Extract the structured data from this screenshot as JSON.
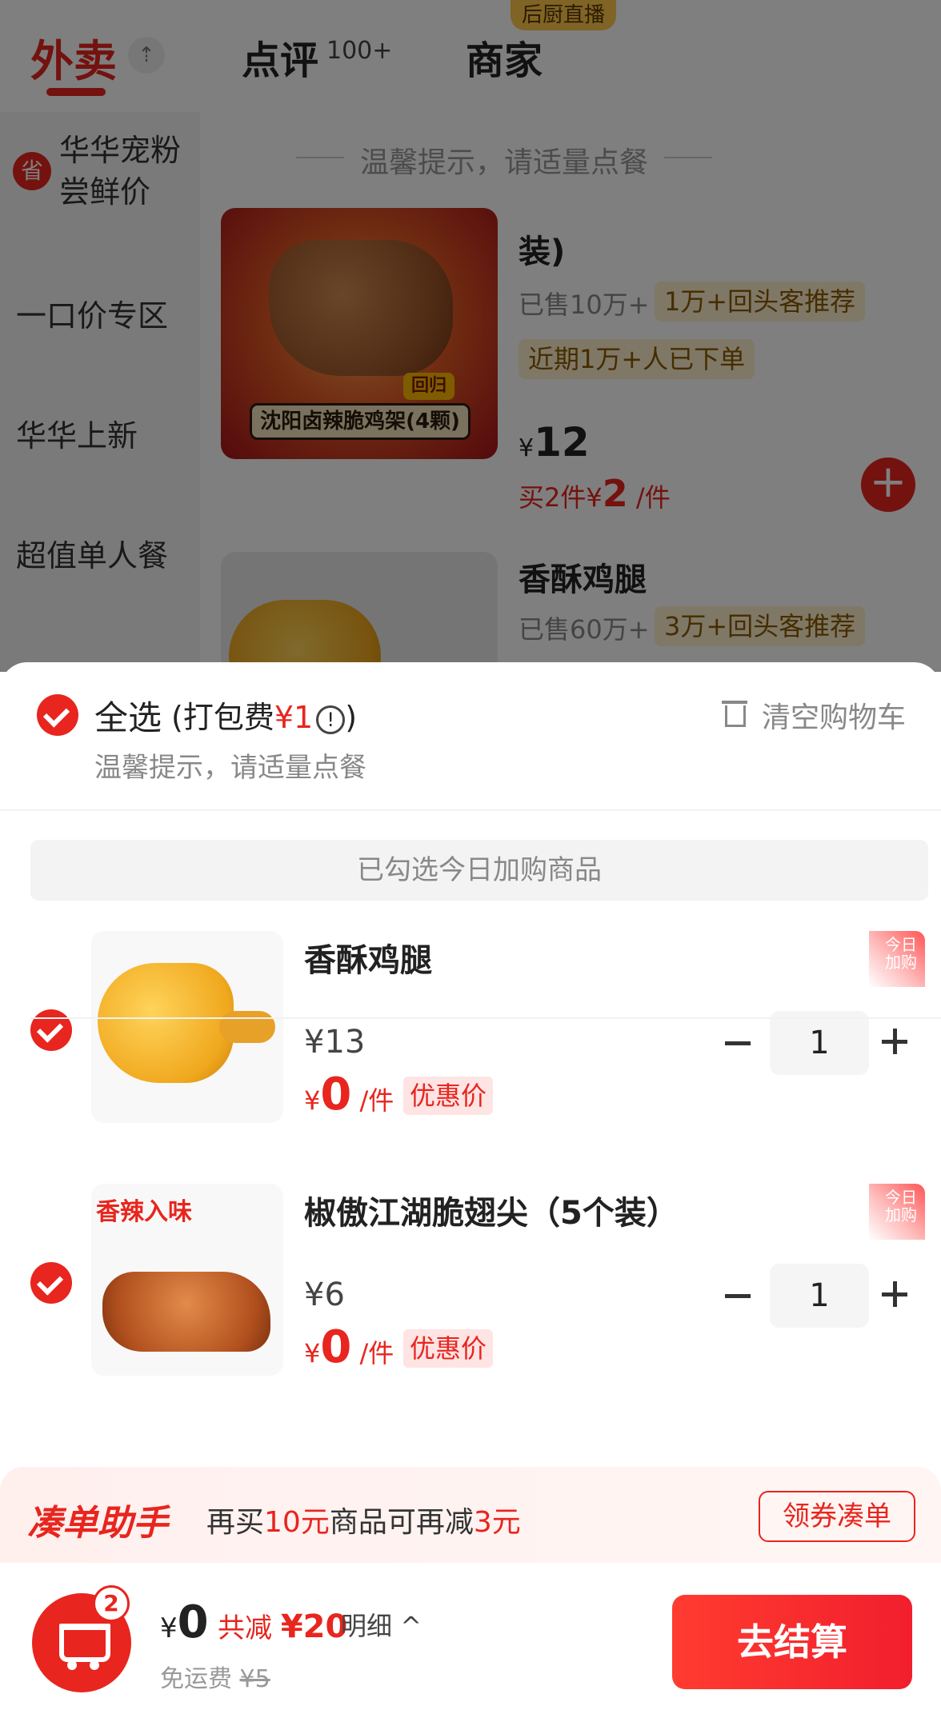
{
  "tabs": {
    "takeout": "外卖",
    "review": "点评",
    "review_count": "100+",
    "merchant": "商家",
    "live_badge": "后厨直播"
  },
  "sidebar": {
    "items": [
      {
        "label": "华华宠粉尝鲜价",
        "badge": "省"
      },
      {
        "label": "一口价专区"
      },
      {
        "label": "华华上新"
      },
      {
        "label": "超值单人餐"
      }
    ]
  },
  "menu": {
    "hint": "温馨提示，请适量点餐",
    "products": [
      {
        "title": "装)",
        "image_caption": "沈阳卤辣脆鸡架(4颗)",
        "image_tag": "回归",
        "sold": "已售10万+",
        "tags": [
          "1万+回头客推荐",
          "近期1万+人已下单"
        ],
        "currency": "¥",
        "price": "12",
        "promo_prefix": "买2件",
        "promo_currency": "¥",
        "promo_price": "2",
        "promo_unit": "/件"
      },
      {
        "title": "香酥鸡腿",
        "sold": "已售60万+",
        "tags": [
          "3万+回头客推荐"
        ]
      }
    ]
  },
  "cart": {
    "select_all": "全选",
    "pack_fee_prefix": "(打包费",
    "pack_fee": "¥1",
    "pack_fee_suffix": ")",
    "hint": "温馨提示，请适量点餐",
    "clear": "清空购物车",
    "section_label": "已勾选今日加购商品",
    "items": [
      {
        "title": "香酥鸡腿",
        "orig_price": "¥13",
        "currency": "¥",
        "now_price": "0",
        "unit": "/件",
        "deal_tag": "优惠价",
        "today_tag": "今日加购",
        "qty": "1"
      },
      {
        "title": "椒傲江湖脆翅尖（5个装）",
        "image_text": "香辣入味",
        "orig_price": "¥6",
        "currency": "¥",
        "now_price": "0",
        "unit": "/件",
        "deal_tag": "优惠价",
        "today_tag": "今日加购",
        "qty": "1"
      }
    ]
  },
  "assistant": {
    "brand": "凑单助手",
    "text_a": "再买",
    "amount": "10元",
    "text_b": "商品可再减",
    "discount": "3元",
    "button": "领券凑单"
  },
  "bottom": {
    "cart_count": "2",
    "currency": "¥",
    "total": "0",
    "reduced_label": "共减",
    "reduced_amount": "¥20",
    "detail": "明细",
    "delivery_label": "免运费",
    "delivery_orig": "¥5",
    "checkout": "去结算"
  },
  "colors": {
    "brand_red": "#e8251e",
    "tag_yellow_bg": "#fff1cc",
    "deal_tag_bg": "#ffe4e4"
  }
}
